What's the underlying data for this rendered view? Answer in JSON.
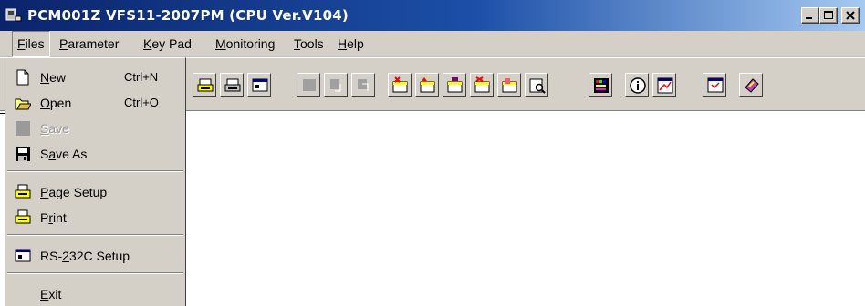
{
  "window": {
    "title": "PCM001Z VFS11-2007PM (CPU Ver.V104)"
  },
  "menubar": {
    "items": [
      {
        "key": "files",
        "label": "Files",
        "accel": "F"
      },
      {
        "key": "parameter",
        "label": "Parameter",
        "accel": "P"
      },
      {
        "key": "keypad",
        "label": "KeyPad",
        "accel": "K"
      },
      {
        "key": "monitoring",
        "label": "Monitoring",
        "accel": "M"
      },
      {
        "key": "tools",
        "label": "Tools",
        "accel": "T"
      },
      {
        "key": "help",
        "label": "Help",
        "accel": "H"
      }
    ]
  },
  "files_menu": {
    "new": {
      "label_accel": "N",
      "label_rest": "ew",
      "shortcut": "Ctrl+N",
      "icon": "new-document-icon"
    },
    "open": {
      "label_accel": "O",
      "label_rest": "pen",
      "shortcut": "Ctrl+O",
      "icon": "open-folder-icon"
    },
    "save": {
      "label_accel": "S",
      "label_rest": "ave",
      "disabled": true,
      "icon": "save-disabled-icon"
    },
    "save_as": {
      "label_pre": "S",
      "label_accel": "a",
      "label_rest": "ve As",
      "icon": "floppy-disk-icon"
    },
    "page_setup": {
      "label_accel": "P",
      "label_rest": "age Setup",
      "icon": "printer-setup-icon"
    },
    "print": {
      "label_pre": "P",
      "label_accel": "r",
      "label_rest": "int",
      "icon": "printer-icon"
    },
    "rs232c": {
      "label_pre": "RS-",
      "label_accel": "2",
      "label_rest": "32C Setup",
      "icon": "terminal-icon"
    },
    "exit": {
      "label_accel": "E",
      "label_rest": "xit"
    }
  },
  "toolbar": {
    "buttons": [
      "printer-setup-icon",
      "printer-icon",
      "terminal-icon",
      "read-disabled-icon",
      "write-down-disabled-icon",
      "write-up-disabled-icon",
      "table-delete-icon",
      "table-up-icon",
      "table-compare-icon",
      "table-red-icon",
      "table-diff-icon",
      "table-search-icon",
      "trace-icon",
      "info-icon",
      "chart-icon",
      "window-icon",
      "book-icon"
    ]
  },
  "colors": {
    "titlebar_start": "#0a246a",
    "titlebar_end": "#a6caf0",
    "face": "#d4d0c8",
    "shadow": "#808080",
    "highlight": "#ffffff"
  }
}
